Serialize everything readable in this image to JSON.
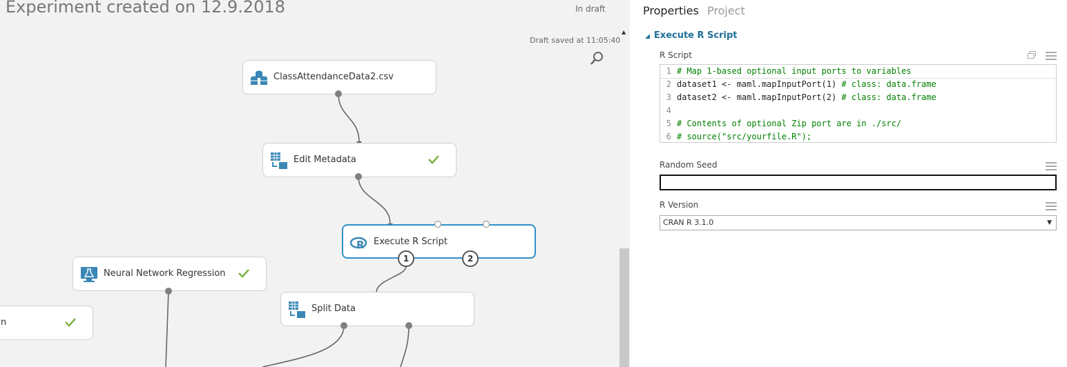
{
  "canvas": {
    "title": "Experiment created on 12.9.2018",
    "status": "In draft",
    "saved_text": "Draft saved at 11:05:40"
  },
  "modules": {
    "dataset": {
      "label": "ClassAttendanceData2.csv"
    },
    "edit_metadata": {
      "label": "Edit Metadata"
    },
    "execute_r": {
      "label": "Execute R Script",
      "port1": "1",
      "port2": "2"
    },
    "nn_regression": {
      "label": "Neural Network Regression"
    },
    "split_data": {
      "label": "Split Data"
    },
    "partial": {
      "label": "n"
    }
  },
  "panel": {
    "tabs": [
      "Properties",
      "Project"
    ],
    "section": "Execute R Script",
    "r_script_label": "R Script",
    "code_lines": [
      {
        "num": "1",
        "text": "# Map 1-based optional input ports to variables",
        "kind": "comment"
      },
      {
        "num": "2",
        "text": "dataset1 <- maml.mapInputPort(1) ",
        "comment": "# class: data.frame",
        "kind": "mixed"
      },
      {
        "num": "3",
        "text": "dataset2 <- maml.mapInputPort(2) ",
        "comment": "# class: data.frame",
        "kind": "mixed"
      },
      {
        "num": "4",
        "text": "",
        "kind": "text"
      },
      {
        "num": "5",
        "text": "# Contents of optional Zip port are in ./src/",
        "kind": "comment"
      },
      {
        "num": "6",
        "text": "# source(\"src/yourfile.R\");",
        "kind": "comment"
      }
    ],
    "random_seed_label": "Random Seed",
    "random_seed_value": "",
    "r_version_label": "R Version",
    "r_version_value": "CRAN R 3.1.0"
  },
  "colors": {
    "accent": "#2f8fc6",
    "check": "#7cb342",
    "section": "#1f6f98",
    "icon": "#3a87b5"
  }
}
